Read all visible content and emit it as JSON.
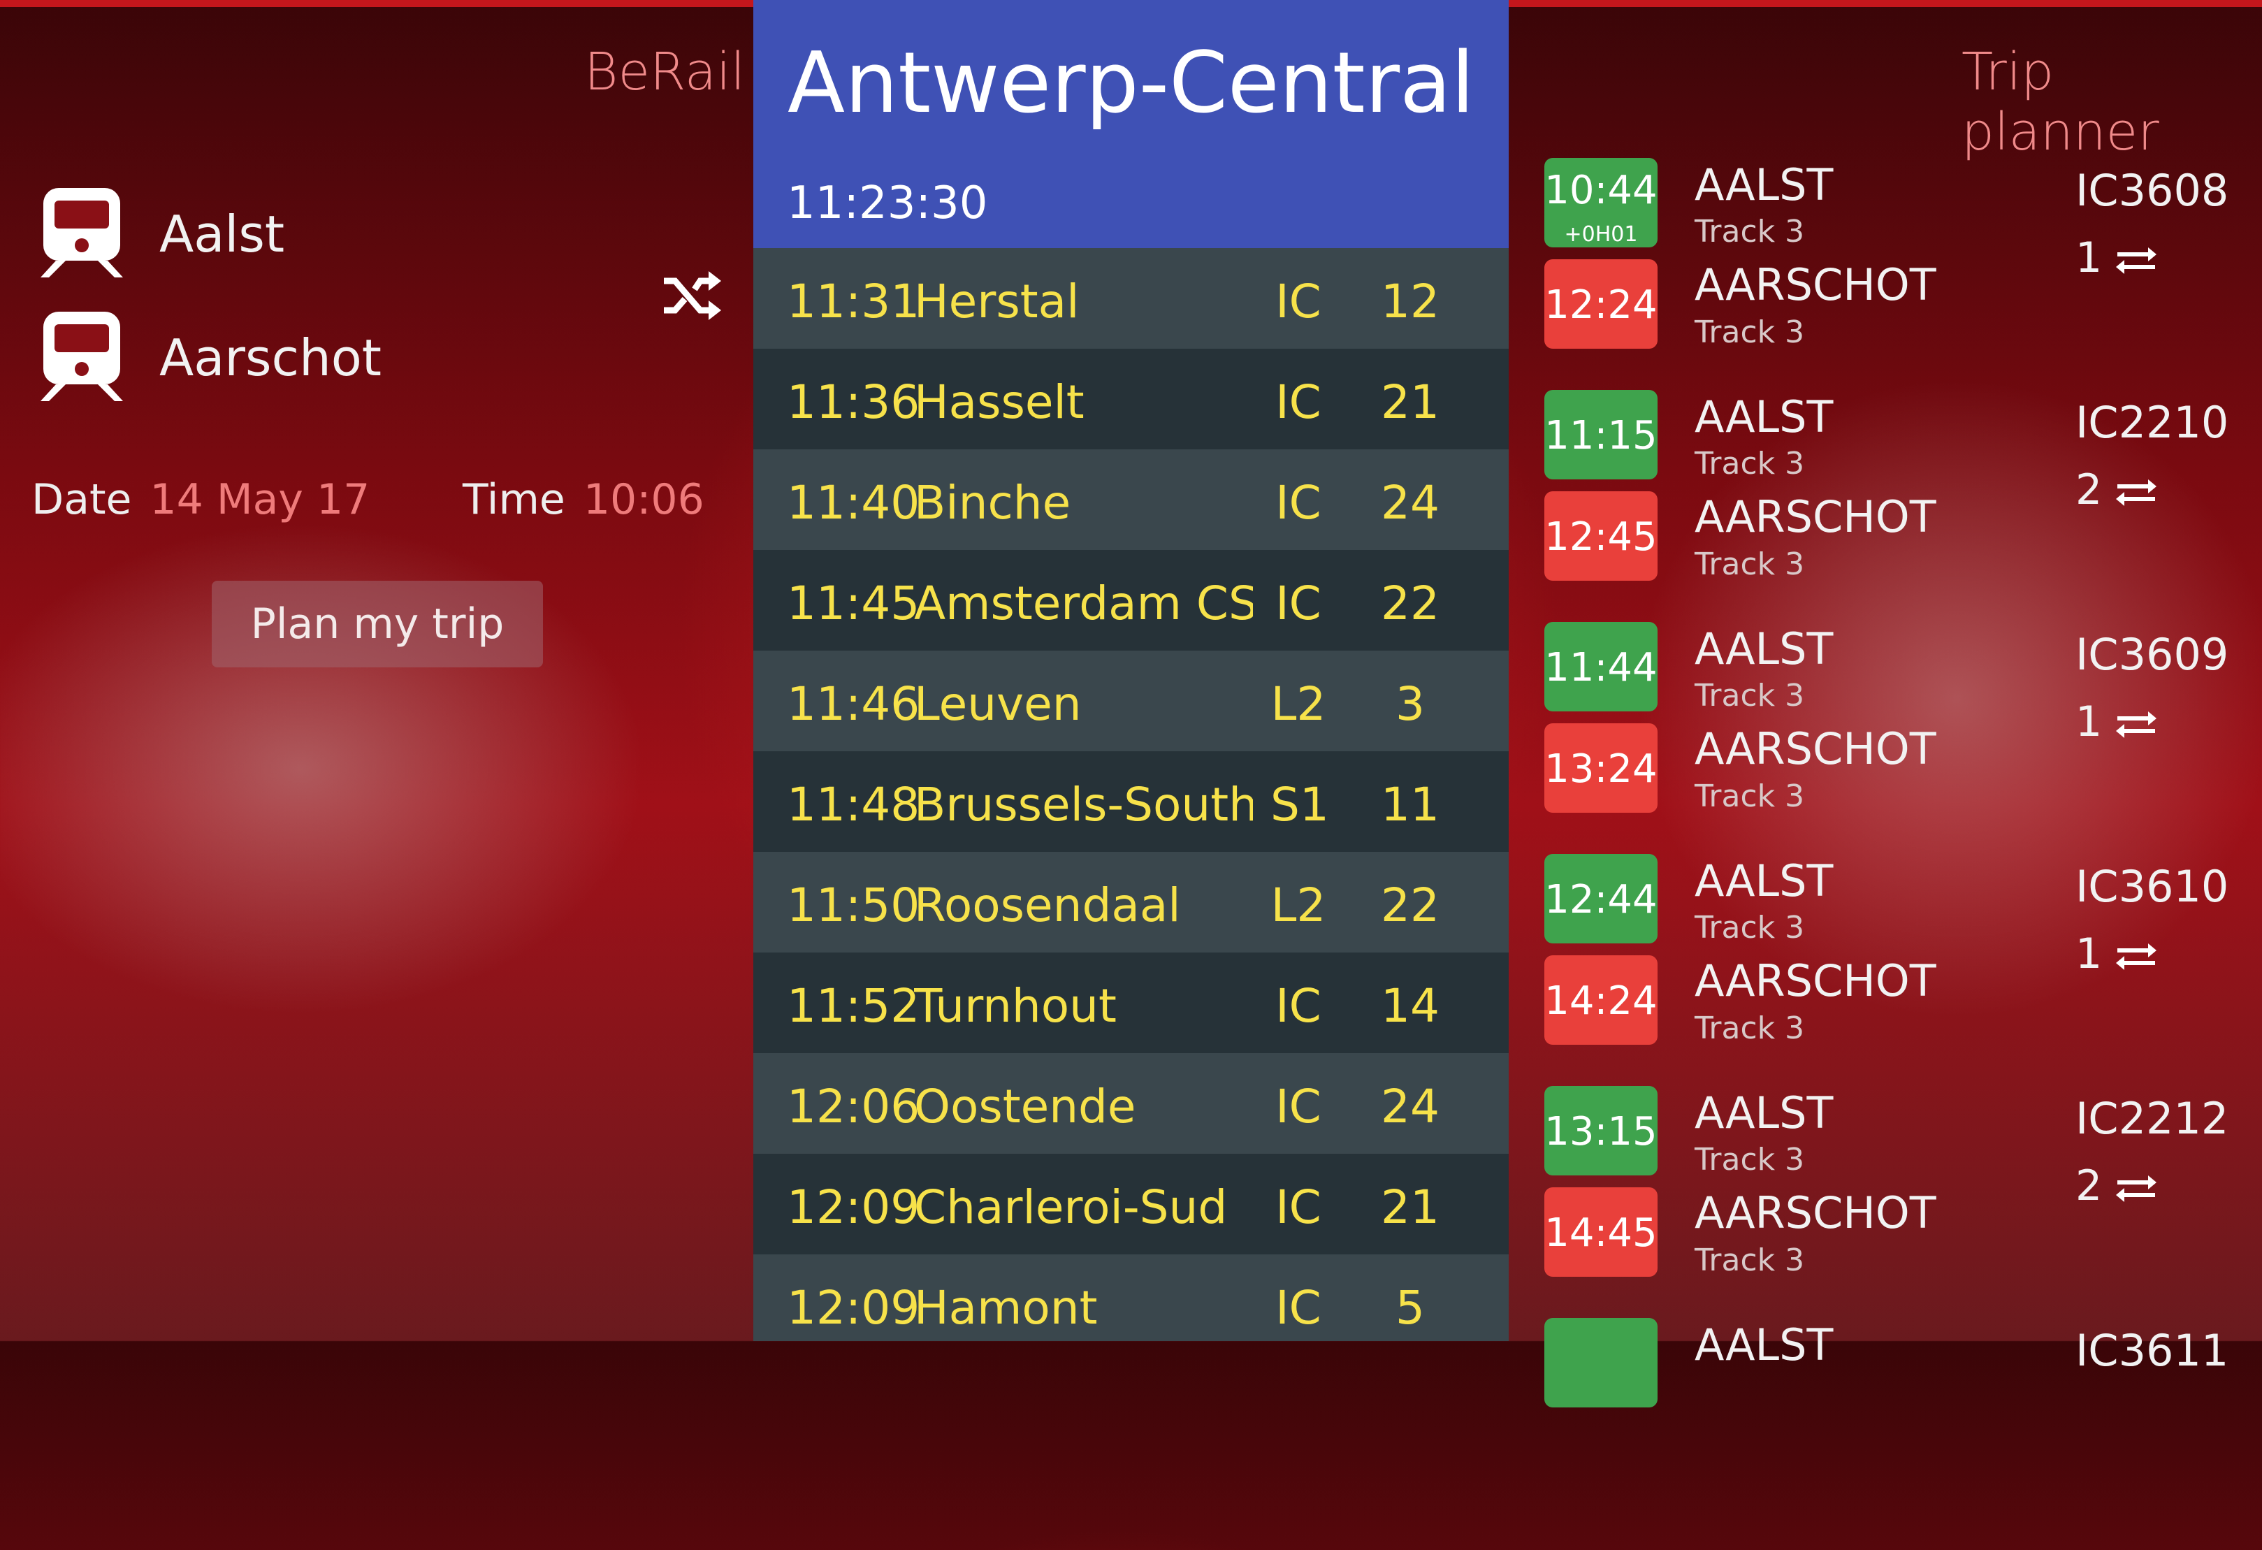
{
  "app": {
    "title": "BeRail"
  },
  "search": {
    "from": "Aalst",
    "to": "Aarschot",
    "date_label": "Date",
    "date_value": "14 May 17",
    "time_label": "Time",
    "time_value": "10:06",
    "plan_button": "Plan my trip"
  },
  "liveboard": {
    "station": "Antwerp-Central",
    "clock": "11:23:30",
    "departures": [
      {
        "time": "11:31",
        "destination": "Herstal",
        "type": "IC",
        "platform": "12"
      },
      {
        "time": "11:36",
        "destination": "Hasselt",
        "type": "IC",
        "platform": "21"
      },
      {
        "time": "11:40",
        "destination": "Binche",
        "type": "IC",
        "platform": "24"
      },
      {
        "time": "11:45",
        "destination": "Amsterdam CS",
        "type": "IC",
        "platform": "22"
      },
      {
        "time": "11:46",
        "destination": "Leuven",
        "type": "L2",
        "platform": "3"
      },
      {
        "time": "11:48",
        "destination": "Brussels-South/Brussels-Midi",
        "type": "S1",
        "platform": "11"
      },
      {
        "time": "11:50",
        "destination": "Roosendaal",
        "type": "L2",
        "platform": "22"
      },
      {
        "time": "11:52",
        "destination": "Turnhout",
        "type": "IC",
        "platform": "14"
      },
      {
        "time": "12:06",
        "destination": "Oostende",
        "type": "IC",
        "platform": "24"
      },
      {
        "time": "12:09",
        "destination": "Charleroi-Sud",
        "type": "IC",
        "platform": "21"
      },
      {
        "time": "12:09",
        "destination": "Hamont",
        "type": "IC",
        "platform": "5"
      }
    ]
  },
  "planner": {
    "title": "Trip planner",
    "trips": [
      {
        "dep_time": "10:44",
        "delay": "+0H01",
        "arr_time": "12:24",
        "from": "AALST",
        "from_track": "Track 3",
        "to": "AARSCHOT",
        "to_track": "Track 3",
        "train": "IC3608",
        "transfers": "1"
      },
      {
        "dep_time": "11:15",
        "delay": "",
        "arr_time": "12:45",
        "from": "AALST",
        "from_track": "Track 3",
        "to": "AARSCHOT",
        "to_track": "Track 3",
        "train": "IC2210",
        "transfers": "2"
      },
      {
        "dep_time": "11:44",
        "delay": "",
        "arr_time": "13:24",
        "from": "AALST",
        "from_track": "Track 3",
        "to": "AARSCHOT",
        "to_track": "Track 3",
        "train": "IC3609",
        "transfers": "1"
      },
      {
        "dep_time": "12:44",
        "delay": "",
        "arr_time": "14:24",
        "from": "AALST",
        "from_track": "Track 3",
        "to": "AARSCHOT",
        "to_track": "Track 3",
        "train": "IC3610",
        "transfers": "1"
      },
      {
        "dep_time": "13:15",
        "delay": "",
        "arr_time": "14:45",
        "from": "AALST",
        "from_track": "Track 3",
        "to": "AARSCHOT",
        "to_track": "Track 3",
        "train": "IC2212",
        "transfers": "2"
      },
      {
        "dep_time": "",
        "delay": "",
        "arr_time": "",
        "from": "AALST",
        "from_track": "",
        "to": "",
        "to_track": "",
        "train": "IC3611",
        "transfers": ""
      }
    ]
  },
  "colors": {
    "accent_red": "#c4161c",
    "board_header": "#3f51b5",
    "board_text": "#f7e24a",
    "departure_green": "#3fa34d",
    "arrival_red": "#e9403b"
  },
  "icons": [
    "train-icon",
    "swap-icon",
    "transfer-icon"
  ]
}
